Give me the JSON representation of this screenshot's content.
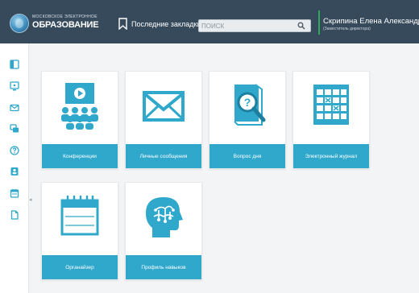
{
  "header": {
    "logo_small": "МОСКОВСКОЕ ЭЛЕКТРОННОЕ",
    "logo_big": "ОБРАЗОВАНИЕ",
    "bookmarks_label": "Последние закладки",
    "search_placeholder": "поиск",
    "user_name": "Скрипина Елена Александровна",
    "user_role": "(Заместитель директора)"
  },
  "sidebar": {
    "icons": [
      "panel-icon",
      "monitor-icon",
      "envelope-icon",
      "chat-icon",
      "question-icon",
      "badge-icon",
      "calendar-icon",
      "document-icon"
    ]
  },
  "tiles": [
    {
      "label": "Конференции",
      "icon": "conference-icon"
    },
    {
      "label": "Личные сообщения",
      "icon": "envelope-icon"
    },
    {
      "label": "Вопрос дня",
      "icon": "question-book-icon"
    },
    {
      "label": "Электронный журнал",
      "icon": "journal-grid-icon"
    },
    {
      "label": "Органайзер",
      "icon": "organizer-calendar-icon"
    },
    {
      "label": "Профиль навыков",
      "icon": "head-brain-icon"
    }
  ],
  "colors": {
    "header_bg": "#364a5c",
    "accent": "#2fa8cc",
    "divider": "#2fa860"
  }
}
